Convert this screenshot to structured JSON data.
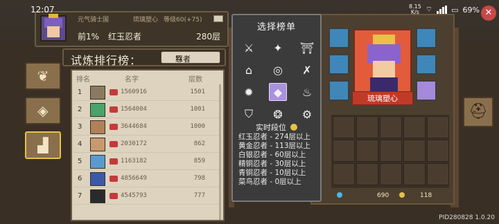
{
  "status_bar": {
    "time": "12:07",
    "net_speed_value": "8.15",
    "net_speed_unit": "K/s",
    "battery": "69%"
  },
  "header": {
    "game_name": "元气骑士国",
    "clan": "琉璃塑心",
    "level_text": "等级60(+75)",
    "percent": "前1%",
    "rank_name": "红玉忍者",
    "floor": "280层"
  },
  "ranking": {
    "title": "试炼排行榜：",
    "class_selected": "忍者",
    "columns": [
      "排名",
      "名字",
      "层数"
    ],
    "rows": [
      {
        "rank": "1",
        "uid": "1560916",
        "floors": "1501"
      },
      {
        "rank": "2",
        "uid": "1564004",
        "floors": "1001"
      },
      {
        "rank": "3",
        "uid": "3644684",
        "floors": "1000"
      },
      {
        "rank": "4",
        "uid": "2030172",
        "floors": "862"
      },
      {
        "rank": "5",
        "uid": "1163182",
        "floors": "859"
      },
      {
        "rank": "6",
        "uid": "4856649",
        "floors": "798"
      },
      {
        "rank": "7",
        "uid": "4545793",
        "floors": "777"
      }
    ]
  },
  "select_panel": {
    "title": "选择榜单",
    "icons": [
      "bow-icon",
      "shuriken-icon",
      "gate-icon",
      "temple-icon",
      "swirl-icon",
      "swords-icon",
      "gear-icon",
      "ninja-icon",
      "flame-icon",
      "shield-icon",
      "vortex-icon",
      "cog-icon"
    ],
    "realtime_label": "实时段位",
    "tiers": [
      "红玉忍者 - 274层以上",
      "黄金忍者 - 113层以上",
      "白银忍者 - 60层以上",
      "精铜忍者 - 30层以上",
      "青铜忍者 - 10层以上",
      "菜鸟忍者 - 0层以上"
    ]
  },
  "hero": {
    "name": "琉璃塑心"
  },
  "inventory_stats": {
    "gems": "690",
    "score": "118"
  },
  "pid": "PID280828 1.0.20",
  "colors": {
    "accent_select": "#a991e0",
    "hero_bg": "#e25c3c",
    "rank_tier_red": "#c43a3a"
  }
}
